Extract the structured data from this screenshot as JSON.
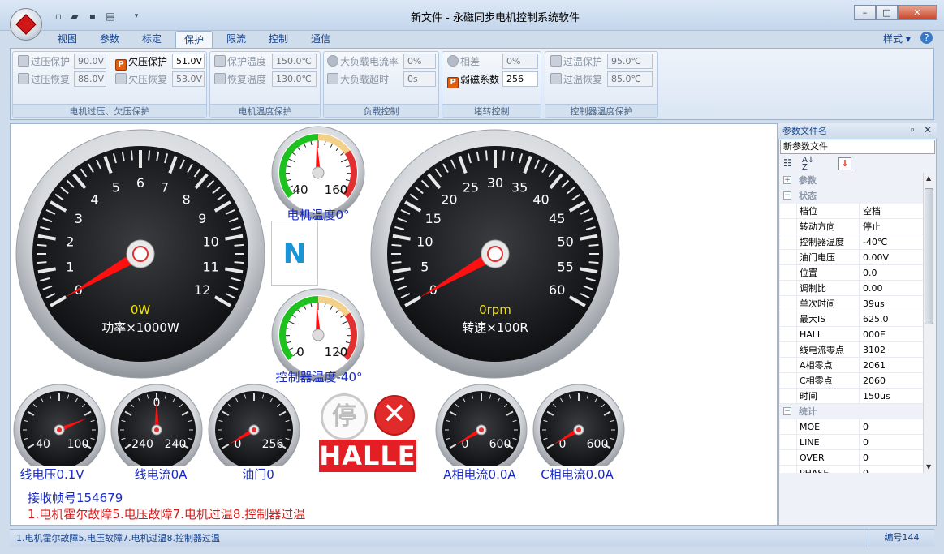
{
  "window": {
    "title": "新文件 - 永磁同步电机控制系统软件",
    "style_menu": "样式"
  },
  "tabs": [
    {
      "label": "视图"
    },
    {
      "label": "参数"
    },
    {
      "label": "标定"
    },
    {
      "label": "保护"
    },
    {
      "label": "限流"
    },
    {
      "label": "控制"
    },
    {
      "label": "通信"
    }
  ],
  "ribbon": {
    "groups": [
      {
        "label": "电机过压、欠压保护"
      },
      {
        "label": "电机温度保护"
      },
      {
        "label": "负载控制"
      },
      {
        "label": "堵转控制"
      },
      {
        "label": "控制器温度保护"
      }
    ],
    "overvolt": {
      "label": "过压保护",
      "value": "90.0V"
    },
    "overvolt_recover": {
      "label": "过压恢复",
      "value": "88.0V"
    },
    "undervolt": {
      "label": "欠压保护",
      "value": "51.0V"
    },
    "undervolt_recover": {
      "label": "欠压恢复",
      "value": "53.0V"
    },
    "motor_temp": {
      "label": "保护温度",
      "value": "150.0℃"
    },
    "motor_temp_recover": {
      "label": "恢复温度",
      "value": "130.0℃"
    },
    "load_rate": {
      "label": "大负载电流率",
      "value": "0%"
    },
    "load_timeout": {
      "label": "大负载超时",
      "value": "0s"
    },
    "phase_diff": {
      "label": "相差",
      "value": "0%"
    },
    "weak_field": {
      "label": "弱磁系数",
      "value": "256"
    },
    "ctrl_temp": {
      "label": "过温保护",
      "value": "95.0℃"
    },
    "ctrl_temp_recover": {
      "label": "过温恢复",
      "value": "85.0℃"
    }
  },
  "gauges": {
    "power": {
      "ticks": [
        "0",
        "1",
        "2",
        "3",
        "4",
        "5",
        "6",
        "7",
        "8",
        "9",
        "10",
        "11",
        "12"
      ],
      "reading": "0W",
      "caption": "功率×1000W",
      "value": 0,
      "max": 12
    },
    "speed": {
      "ticks": [
        "0",
        "5",
        "10",
        "15",
        "20",
        "25",
        "30",
        "35",
        "40",
        "45",
        "50",
        "55",
        "60"
      ],
      "reading": "0rpm",
      "caption": "转速×100R",
      "value": 0,
      "max": 60
    },
    "motor_temp": {
      "min": "40",
      "max": "160",
      "caption": "电机温度0°",
      "value": 0.49
    },
    "ctrl_temp": {
      "min": "0",
      "max": "120",
      "caption": "控制器温度-40°",
      "value": 0.49
    },
    "line_voltage": {
      "min": "40",
      "max": "100",
      "caption": "线电压0.1V",
      "value": 0.78
    },
    "line_current": {
      "top": "0",
      "min": "-240",
      "max": "240",
      "caption": "线电流0A",
      "value": 0.5
    },
    "throttle": {
      "min": "0",
      "max": "256",
      "caption": "油门0",
      "value": 0
    },
    "phase_a": {
      "min": "0",
      "max": "600",
      "caption": "A相电流0.0A",
      "value": 0
    },
    "phase_c": {
      "min": "0",
      "max": "600",
      "caption": "C相电流0.0A",
      "value": 0
    }
  },
  "gear_indicator": "N",
  "stop_icon_text": "停",
  "halle_badge": "HALLE",
  "rx_frames": "接收帧号154679",
  "fault_text": "1.电机霍尔故障5.电压故障7.电机过温8.控制器过温",
  "panel": {
    "title": "参数文件名",
    "file_name": "新参数文件",
    "categories": [
      {
        "name": "参数",
        "expanded": false,
        "rows": []
      },
      {
        "name": "状态",
        "expanded": true,
        "rows": [
          {
            "key": "档位",
            "value": "空档"
          },
          {
            "key": "转动方向",
            "value": "停止"
          },
          {
            "key": "控制器温度",
            "value": "-40℃"
          },
          {
            "key": "油门电压",
            "value": "0.00V"
          },
          {
            "key": "位置",
            "value": "0.0"
          },
          {
            "key": "调制比",
            "value": "0.00"
          },
          {
            "key": "单次时间",
            "value": "39us"
          },
          {
            "key": "最大IS",
            "value": "625.0"
          },
          {
            "key": "HALL",
            "value": "000E"
          },
          {
            "key": "线电流零点",
            "value": "3102"
          },
          {
            "key": "A相零点",
            "value": "2061"
          },
          {
            "key": "C相零点",
            "value": "2060"
          },
          {
            "key": "时间",
            "value": "150us"
          }
        ]
      },
      {
        "name": "统计",
        "expanded": true,
        "rows": [
          {
            "key": "MOE",
            "value": "0"
          },
          {
            "key": "LINE",
            "value": "0"
          },
          {
            "key": "OVER",
            "value": "0"
          },
          {
            "key": "PHASE",
            "value": "0"
          }
        ]
      }
    ]
  },
  "status_bar": {
    "message": "1.电机霍尔故障5.电压故障7.电机过温8.控制器过温",
    "serial": "编号144"
  }
}
